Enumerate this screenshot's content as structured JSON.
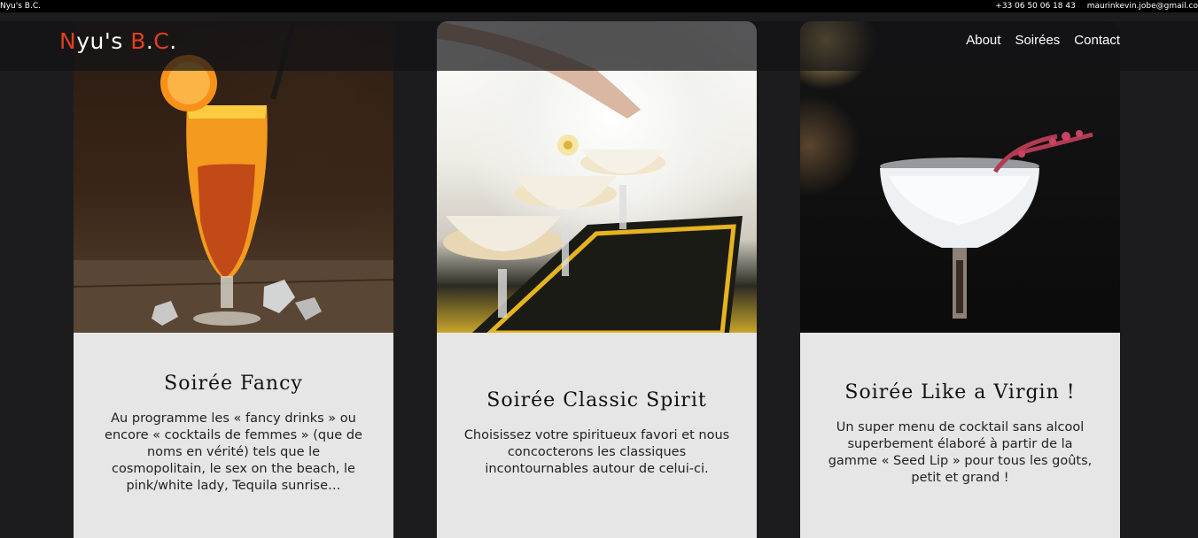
{
  "topbar": {
    "brand": "Nyu's B.C.",
    "phone": "+33 06 50 06 18 43",
    "email": "maurinkevin.jobe@gmail.co"
  },
  "logo": {
    "letters": [
      "N",
      "yu's ",
      "B",
      ".",
      "C",
      "."
    ]
  },
  "nav": {
    "items": [
      {
        "label": "About"
      },
      {
        "label": "Soirées"
      },
      {
        "label": "Contact"
      }
    ]
  },
  "cards": [
    {
      "title": "Soirée Fancy",
      "text": "Au programme les « fancy drinks » ou encore « cocktails de femmes » (que de noms en vérité) tels que le cosmopolitain, le sex on the beach, le pink/white lady, Tequila sunrise…",
      "image": "orange-cocktail-photo"
    },
    {
      "title": "Soirée Classic Spirit",
      "text": "Choisissez votre spiritueux favori et nous concocterons les classiques incontournables autour de celui-ci.",
      "image": "classic-cocktails-photo"
    },
    {
      "title": "Soirée Like a Virgin !",
      "text": "Un super menu de cocktail sans alcool superbement élaboré à partir de la gamme « Seed Lip » pour tous les goûts, petit et grand !",
      "image": "virgin-cocktail-photo"
    }
  ],
  "colors": {
    "accent": "#e0401f",
    "card_body": "#e6e6e6",
    "background": "#1c1c1e"
  }
}
